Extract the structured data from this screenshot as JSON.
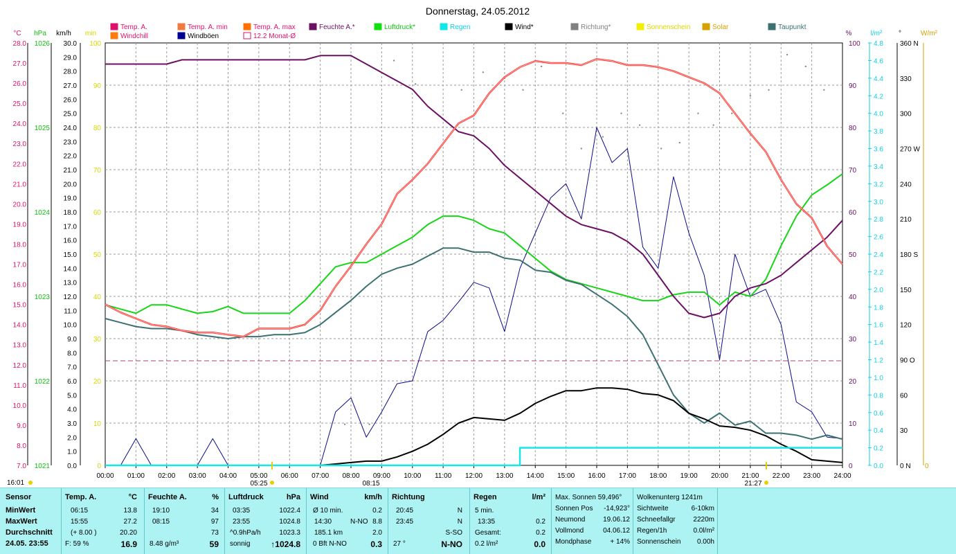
{
  "title": "Donnerstag, 24.05.2012",
  "colors": {
    "temp": "#e8344a",
    "temp_line": "#ff3030",
    "humidity": "#6b0f63",
    "pressure": "#16d616",
    "rain": "#15e6e6",
    "wind": "#000000",
    "gust": "#0a0a8a",
    "dew": "#3d7171",
    "monthly": "#b04070",
    "grid": "#8a8a8a",
    "panel_bg": "#aef3f3"
  },
  "legend": [
    {
      "label": "Temp. A.",
      "color": "#e0106a",
      "text_color": "#e0106a",
      "style": "fill"
    },
    {
      "label": "Windchill",
      "color": "#ff7a10",
      "text_color": "#e0106a",
      "style": "fill"
    },
    {
      "label": "Temp. A. min",
      "color": "#f07a40",
      "text_color": "#e0106a",
      "style": "fill"
    },
    {
      "label": "Windböen",
      "color": "#000090",
      "text_color": "#000000",
      "style": "fill"
    },
    {
      "label": "Temp. A. max",
      "color": "#ff7000",
      "text_color": "#e0106a",
      "style": "fill"
    },
    {
      "label": "12.2 Monat-Ø",
      "color": "#e0106a",
      "text_color": "#e0106a",
      "style": "outline"
    },
    {
      "label": "Feuchte A.*",
      "color": "#6b0f63",
      "text_color": "#6b0f63",
      "style": "fill"
    },
    {
      "label": "Luftdruck*",
      "color": "#10e010",
      "text_color": "#10c010",
      "style": "fill"
    },
    {
      "label": "Regen",
      "color": "#10e8e8",
      "text_color": "#10d0e0",
      "style": "fill"
    },
    {
      "label": "Wind*",
      "color": "#000000",
      "text_color": "#000000",
      "style": "fill"
    },
    {
      "label": "Richtung*",
      "color": "#808080",
      "text_color": "#808080",
      "style": "fill"
    },
    {
      "label": "Sonnenschein",
      "color": "#f0f000",
      "text_color": "#d8d800",
      "style": "fill"
    },
    {
      "label": "Solar",
      "color": "#d8a000",
      "text_color": "#d8a000",
      "style": "fill"
    },
    {
      "label": "Taupunkt",
      "color": "#3d7171",
      "text_color": "#3d7171",
      "style": "fill"
    }
  ],
  "axes": {
    "temp": {
      "unit": "°C",
      "ticks": [
        "28.0",
        "27.0",
        "26.0",
        "25.0",
        "24.0",
        "23.0",
        "22.0",
        "21.0",
        "20.0",
        "19.0",
        "18.0",
        "17.0",
        "16.0",
        "15.0",
        "14.0",
        "13.0",
        "12.0",
        "11.0",
        "10.0",
        "9.0",
        "8.0",
        "7.0"
      ]
    },
    "pressure": {
      "unit": "hPa",
      "ticks": [
        "1026",
        "1025",
        "1024",
        "1023",
        "1022",
        "1021"
      ]
    },
    "wind": {
      "unit": "km/h",
      "ticks": [
        "30.0",
        "29.0",
        "28.0",
        "27.0",
        "26.0",
        "25.0",
        "24.0",
        "23.0",
        "22.0",
        "21.0",
        "20.0",
        "19.0",
        "18.0",
        "17.0",
        "16.0",
        "15.0",
        "14.0",
        "13.0",
        "12.0",
        "11.0",
        "10.0",
        "9.0",
        "8.0",
        "7.0",
        "6.0",
        "5.0",
        "4.0",
        "3.0",
        "2.0",
        "1.0",
        "0.0"
      ]
    },
    "min": {
      "unit": "min",
      "ticks": [
        "100",
        "90",
        "80",
        "70",
        "60",
        "50",
        "40",
        "30",
        "20",
        "10",
        "0"
      ]
    },
    "humidity": {
      "unit": "%",
      "ticks": [
        "100",
        "90",
        "80",
        "70",
        "60",
        "50",
        "40",
        "30",
        "20",
        "10",
        "0"
      ]
    },
    "rain": {
      "unit": "l/m²",
      "ticks": [
        "4.8",
        "4.6",
        "4.4",
        "4.2",
        "4.0",
        "3.8",
        "3.6",
        "3.4",
        "3.2",
        "3.0",
        "2.8",
        "2.6",
        "2.4",
        "2.2",
        "2.0",
        "1.8",
        "1.6",
        "1.4",
        "1.2",
        "1.0",
        "0.8",
        "0.6",
        "0.4",
        "0.2",
        "0.0"
      ]
    },
    "direction": {
      "unit": "°",
      "ticks": [
        "360 N",
        "330",
        "300",
        "270 W",
        "240",
        "210",
        "180 S",
        "150",
        "120",
        "90  O",
        "60",
        "30",
        "0    N"
      ]
    },
    "solar": {
      "unit": "W/m²",
      "ticks": [
        "0"
      ]
    },
    "x": {
      "ticks": [
        "00:00",
        "01:00",
        "02:00",
        "03:00",
        "04:00",
        "05:00",
        "06:00",
        "07:00",
        "08:00",
        "09:00",
        "10:00",
        "11:00",
        "12:00",
        "13:00",
        "14:00",
        "15:00",
        "16:00",
        "17:00",
        "18:00",
        "19:00",
        "20:00",
        "21:00",
        "22:00",
        "23:00",
        "24:00"
      ]
    }
  },
  "markers": {
    "day_start": "16:01",
    "sunrise": "05:25",
    "solar_noon": "08:15",
    "sunset": "21:27"
  },
  "chart_data": {
    "type": "line",
    "title": "Donnerstag, 24.05.2012",
    "x_range": [
      "00:00",
      "24:00"
    ],
    "x_hours": [
      0,
      0.5,
      1,
      1.5,
      2,
      2.5,
      3,
      3.5,
      4,
      4.5,
      5,
      5.5,
      6,
      6.5,
      7,
      7.5,
      8,
      8.5,
      9,
      9.5,
      10,
      10.5,
      11,
      11.5,
      12,
      12.5,
      13,
      13.5,
      14,
      14.5,
      15,
      15.5,
      16,
      16.5,
      17,
      17.5,
      18,
      18.5,
      19,
      19.5,
      20,
      20.5,
      21,
      21.5,
      22,
      22.5,
      23,
      23.5,
      24
    ],
    "series": [
      {
        "name": "Temp. A.",
        "axis": "temp",
        "ylim": [
          7,
          28
        ],
        "values": [
          15.0,
          14.6,
          14.3,
          14.0,
          13.9,
          13.7,
          13.6,
          13.6,
          13.5,
          13.4,
          13.8,
          13.8,
          13.8,
          14.0,
          14.7,
          15.9,
          16.9,
          18.0,
          19.0,
          20.5,
          21.2,
          22.0,
          23.0,
          24.0,
          24.4,
          25.5,
          26.3,
          26.8,
          27.1,
          27.0,
          27.0,
          26.9,
          27.2,
          27.1,
          26.9,
          26.9,
          26.8,
          26.6,
          26.3,
          26.0,
          25.5,
          24.5,
          23.5,
          22.6,
          21.2,
          20.0,
          19.3,
          17.9,
          17.0
        ]
      },
      {
        "name": "Feuchte A.*",
        "axis": "humidity",
        "ylim": [
          0,
          100
        ],
        "values": [
          95,
          95,
          95,
          95,
          95,
          96,
          96,
          96,
          96,
          96,
          96,
          96,
          96,
          96,
          97,
          97,
          97,
          95,
          93,
          91,
          89,
          85,
          82,
          79,
          78,
          75,
          71,
          68,
          65,
          62,
          59,
          57,
          56,
          55,
          53,
          50,
          45,
          40,
          36,
          35,
          36,
          40,
          42,
          43,
          45,
          48,
          51,
          54,
          58
        ]
      },
      {
        "name": "Luftdruck*",
        "axis": "pressure",
        "ylim": [
          1021,
          1026
        ],
        "values": [
          1022.9,
          1022.85,
          1022.8,
          1022.9,
          1022.9,
          1022.85,
          1022.8,
          1022.82,
          1022.88,
          1022.8,
          1022.8,
          1022.8,
          1022.8,
          1022.95,
          1023.15,
          1023.35,
          1023.4,
          1023.4,
          1023.5,
          1023.6,
          1023.7,
          1023.85,
          1023.95,
          1023.95,
          1023.9,
          1023.8,
          1023.75,
          1023.6,
          1023.45,
          1023.3,
          1023.2,
          1023.15,
          1023.1,
          1023.05,
          1023.0,
          1022.95,
          1022.95,
          1023.02,
          1023.05,
          1023.05,
          1022.9,
          1023.05,
          1023.0,
          1023.2,
          1023.6,
          1023.95,
          1024.2,
          1024.32,
          1024.45
        ]
      },
      {
        "name": "Taupunkt",
        "axis": "temp",
        "ylim": [
          7,
          28
        ],
        "values": [
          14.3,
          14.1,
          13.9,
          13.8,
          13.8,
          13.7,
          13.5,
          13.4,
          13.3,
          13.4,
          13.4,
          13.5,
          13.5,
          13.6,
          14.0,
          14.6,
          15.2,
          15.9,
          16.5,
          16.8,
          17.0,
          17.4,
          17.8,
          17.8,
          17.6,
          17.6,
          17.3,
          17.2,
          16.7,
          16.6,
          16.2,
          16.0,
          15.5,
          15.0,
          14.4,
          13.5,
          12.0,
          10.5,
          9.6,
          9.1,
          9.6,
          9.0,
          9.2,
          8.6,
          8.6,
          8.5,
          8.3,
          8.5,
          8.3
        ]
      },
      {
        "name": "Wind*",
        "axis": "wind",
        "ylim": [
          0,
          30
        ],
        "values": [
          0,
          0,
          0,
          0,
          0,
          0,
          0,
          0,
          0,
          0,
          0,
          0,
          0,
          0,
          0,
          0.1,
          0.2,
          0.3,
          0.3,
          0.6,
          1.0,
          1.5,
          2.2,
          3.0,
          3.4,
          3.3,
          3.2,
          3.7,
          4.4,
          4.9,
          5.3,
          5.3,
          5.5,
          5.5,
          5.4,
          5.1,
          5.0,
          4.6,
          3.7,
          3.3,
          2.8,
          2.7,
          2.5,
          2.1,
          1.5,
          1.0,
          0.4,
          0.3,
          0.2
        ]
      },
      {
        "name": "Windböen",
        "axis": "wind",
        "ylim": [
          0,
          30
        ],
        "values": [
          0,
          0,
          1.9,
          0,
          0,
          0,
          0,
          1.9,
          0,
          0,
          0,
          0,
          0,
          0,
          0,
          3.8,
          4.8,
          2.0,
          3.8,
          5.8,
          6.0,
          9.5,
          10.3,
          11.6,
          13.0,
          12.6,
          9.5,
          14.0,
          16.5,
          19.0,
          20.0,
          17.5,
          24.0,
          21.5,
          22.5,
          15.5,
          14.0,
          20.5,
          16.5,
          13.5,
          7.5,
          15.0,
          12.0,
          12.5,
          10.0,
          4.5,
          3.8,
          2.0,
          1.9
        ]
      },
      {
        "name": "Regen",
        "axis": "rain",
        "ylim": [
          0,
          4.8
        ],
        "values": [
          0,
          0,
          0,
          0,
          0,
          0,
          0,
          0,
          0,
          0,
          0,
          0,
          0,
          0,
          0,
          0,
          0,
          0,
          0,
          0,
          0,
          0,
          0,
          0,
          0,
          0,
          0,
          0.2,
          0.2,
          0.2,
          0.2,
          0.2,
          0.2,
          0.2,
          0.2,
          0.2,
          0.2,
          0.2,
          0.2,
          0.2,
          0.2,
          0.2,
          0.2,
          0.2,
          0.2,
          0.2,
          0.2,
          0.2,
          0.2
        ]
      }
    ],
    "monthly_avg_temp": 12.2,
    "direction_points": [
      [
        7.8,
        35
      ],
      [
        8.6,
        35
      ],
      [
        9.4,
        345
      ],
      [
        10.1,
        325
      ],
      [
        10.9,
        360
      ],
      [
        11.6,
        320
      ],
      [
        12.3,
        335
      ],
      [
        13.0,
        330
      ],
      [
        13.6,
        320
      ],
      [
        14.2,
        340
      ],
      [
        14.9,
        300
      ],
      [
        15.5,
        270
      ],
      [
        16.2,
        280
      ],
      [
        16.8,
        300
      ],
      [
        17.4,
        290
      ],
      [
        18.1,
        270
      ],
      [
        18.7,
        275
      ],
      [
        19.3,
        300
      ],
      [
        19.8,
        290
      ],
      [
        20.4,
        300
      ],
      [
        21.0,
        315
      ],
      [
        21.6,
        320
      ],
      [
        22.2,
        350
      ],
      [
        22.8,
        340
      ],
      [
        23.4,
        320
      ]
    ]
  },
  "panel": {
    "sensor": {
      "header": "Sensor",
      "rows": [
        "MinWert",
        "MaxWert",
        "Durchschnitt",
        "24.05. 23:55"
      ]
    },
    "temp": {
      "header": "Temp. A.",
      "unit": "°C",
      "min_time": "06:15",
      "min_val": "13.8",
      "max_time": "15:55",
      "max_val": "27.2",
      "avg_note": "(+ 8.00 )",
      "avg_val": "20.20",
      "cur_note": "F: 59 %",
      "cur_val": "16.9"
    },
    "hum": {
      "header": "Feuchte A.",
      "unit": "%",
      "min_time": "19:10",
      "min_val": "34",
      "max_time": "08:15",
      "max_val": "97",
      "avg_val": "73",
      "cur_note": "8.48 g/m³",
      "cur_val": "59"
    },
    "press": {
      "header": "Luftdruck",
      "unit": "hPa",
      "min_time": "03:35",
      "min_val": "1022.4",
      "max_time": "23:55",
      "max_val": "1024.8",
      "avg_note": "^0.9hPa/h",
      "avg_val": "1023.3",
      "cur_note": "sonnig",
      "cur_val": "↑1024.8"
    },
    "wind": {
      "header": "Wind",
      "unit": "km/h",
      "r1_label": "Ø 10 min.",
      "r1_val": "0.2",
      "r2_time": "14:30",
      "r2_dir": "N-NO",
      "r2_val": "8.8",
      "r3_label": "185.1 km",
      "r3_val": "2.0",
      "r4_label": "0 Bft N-NO",
      "r4_val": "0.3"
    },
    "dir": {
      "header": "Richtung",
      "r1_time": "20:45",
      "r1_val": "N",
      "r2_time": "23:45",
      "r2_val": "N",
      "r3_val": "S-SO",
      "r4_label": "27 °",
      "r4_val": "N-NO"
    },
    "rain": {
      "header": "Regen",
      "unit": "l/m²",
      "r1_label": "5 min.",
      "r2_time": "13:35",
      "r2_val": "0.2",
      "r3_label": "Gesamt:",
      "r3_val": "0.2",
      "r4_label": "0.2 l/m²",
      "r4_val": "0.0"
    },
    "sun": {
      "r1": "Max. Sonnen 59,496°",
      "r2_label": "Sonnen Pos",
      "r2_val": "-14,923°",
      "r3_label": "Neumond",
      "r3_val": "19.06.12",
      "r4_label": "Vollmond",
      "r4_val": "04.06.12",
      "r5_label": "Mondphase",
      "r5_val": "+ 14%"
    },
    "misc": {
      "r1": "Wolkenunterg 1241m",
      "r2_label": "Sichtweite",
      "r2_val": "6-10km",
      "r3_label": "Schneefallgr",
      "r3_val": "2220m",
      "r4_label": "Regen/1h",
      "r4_val": "0.0l/m²",
      "r5_label": "Sonnenschein",
      "r5_val": "0.00h"
    }
  }
}
